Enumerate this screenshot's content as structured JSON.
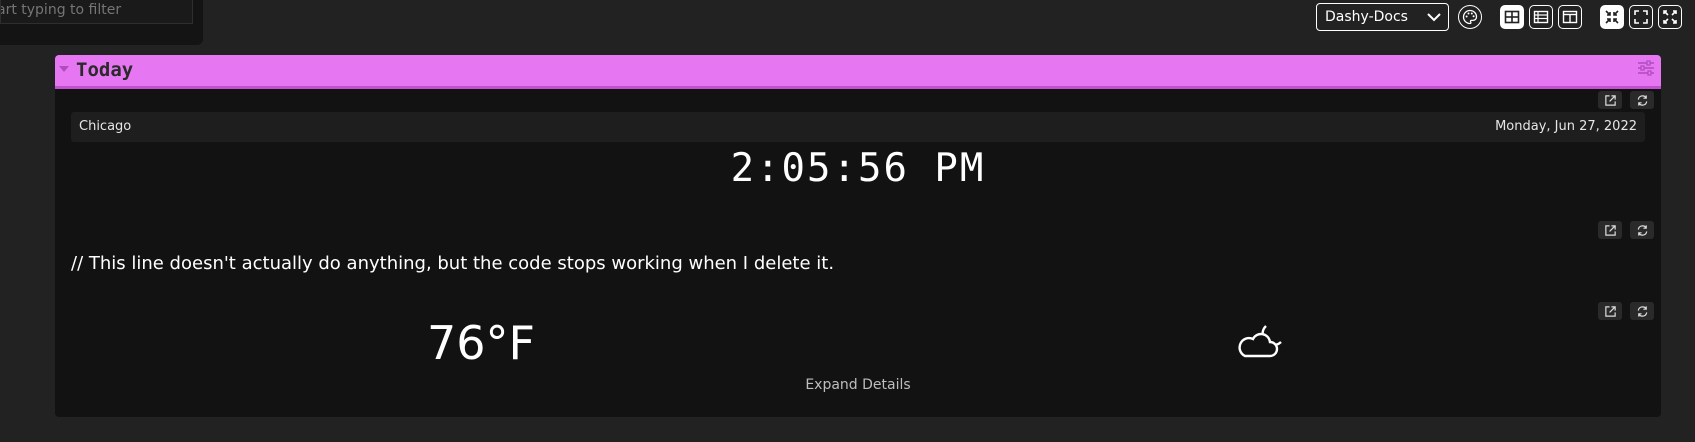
{
  "filter": {
    "placeholder": "art typing to filter"
  },
  "header": {
    "theme_value": "Dashy-Docs",
    "buttons": [
      {
        "icon": "theme-palette-icon",
        "active": false
      },
      {
        "icon": "layout-auto-icon",
        "active": true
      },
      {
        "icon": "layout-vertical-icon",
        "active": false
      },
      {
        "icon": "layout-horizontal-icon",
        "active": false
      },
      {
        "icon": "item-size-small-icon",
        "active": true
      },
      {
        "icon": "item-size-medium-icon",
        "active": false
      },
      {
        "icon": "item-size-large-icon",
        "active": false
      }
    ]
  },
  "section": {
    "title": "Today",
    "accent_color": "#e676f2"
  },
  "clock": {
    "city": "Chicago",
    "date": "Monday, Jun 27, 2022",
    "time": "2:05:56 PM"
  },
  "joke": {
    "text": "// This line doesn't actually do anything, but the code stops working when I delete it."
  },
  "weather": {
    "temperature": "76°F",
    "icon": "partly-cloudy-night-icon",
    "expand_label": "Expand Details"
  }
}
